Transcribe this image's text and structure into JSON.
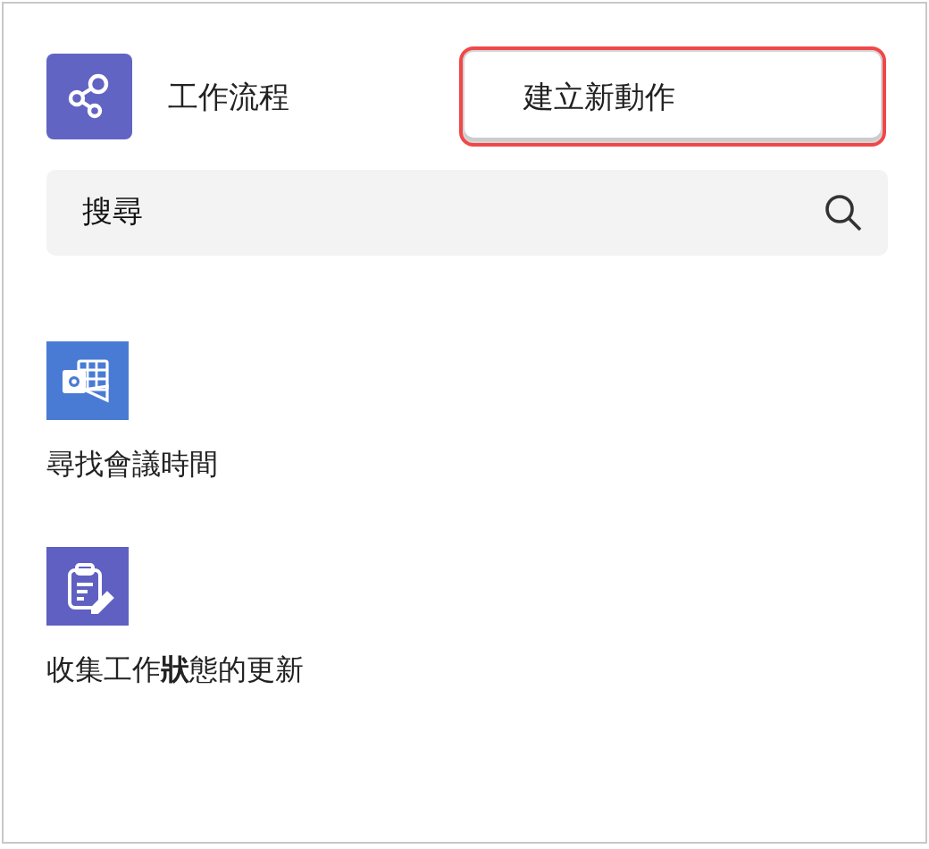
{
  "header": {
    "title": "工作流程",
    "action_button": {
      "label": "建立新動作",
      "highlighted": true
    }
  },
  "search": {
    "placeholder": "搜尋"
  },
  "workflows": [
    {
      "kind": "calendar",
      "label": "尋找會議時間",
      "color": "#4a7bd4"
    },
    {
      "kind": "clipboard",
      "label": "收集工作**狀**態的更新",
      "color": "#5f60c2"
    }
  ]
}
